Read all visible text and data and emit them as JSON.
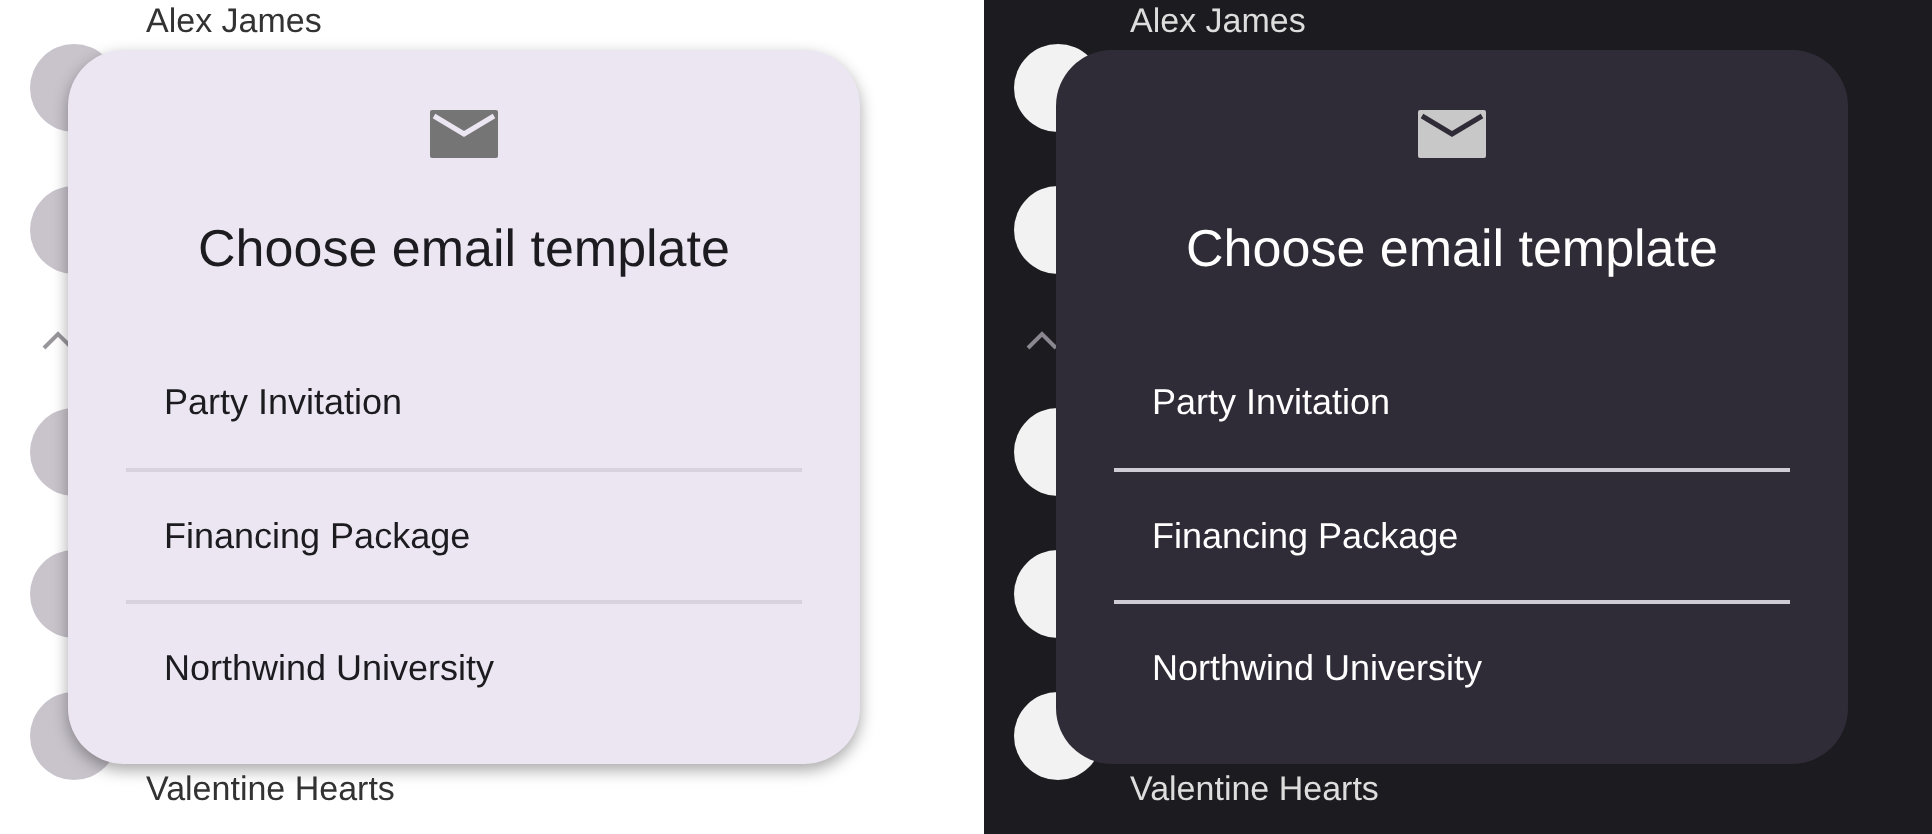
{
  "panels": [
    {
      "dark": false,
      "contacts": [
        {
          "kind": "contact",
          "name": "Alex James"
        },
        {
          "kind": "contact"
        },
        {
          "kind": "chevron"
        },
        {
          "kind": "contact"
        },
        {
          "kind": "contact"
        },
        {
          "kind": "contact",
          "name": "Valentine Hearts"
        }
      ],
      "dialog": {
        "title": "Choose email template",
        "items": [
          "Party Invitation",
          "Financing Package",
          "Northwind University"
        ]
      }
    },
    {
      "dark": true,
      "contacts": [
        {
          "kind": "contact",
          "name": "Alex James"
        },
        {
          "kind": "contact"
        },
        {
          "kind": "chevron"
        },
        {
          "kind": "contact"
        },
        {
          "kind": "contact"
        },
        {
          "kind": "contact",
          "name": "Valentine Hearts"
        }
      ],
      "dialog": {
        "title": "Choose email template",
        "items": [
          "Party Invitation",
          "Financing Package",
          "Northwind University"
        ]
      }
    }
  ]
}
